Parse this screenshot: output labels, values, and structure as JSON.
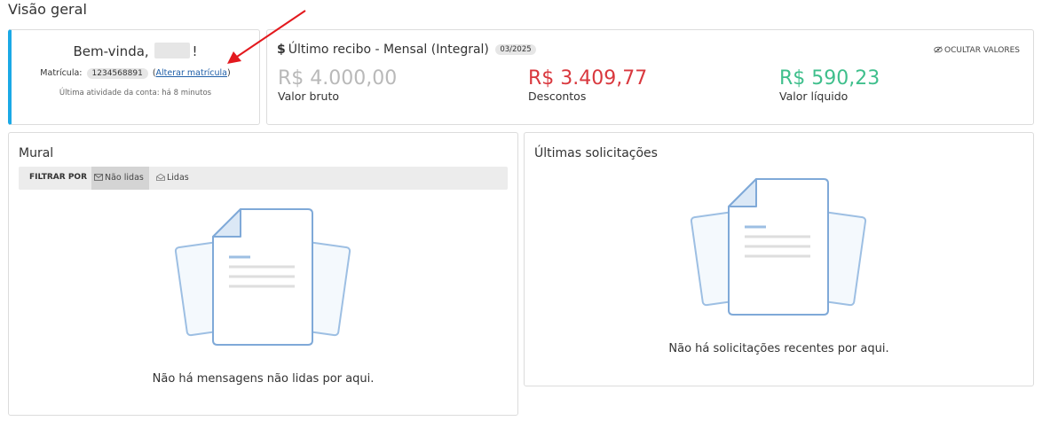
{
  "page": {
    "title": "Visão geral"
  },
  "welcome": {
    "greeting": "Bem-vinda,",
    "exclamation": "!",
    "matricula_label": "Matrícula:",
    "matricula_value": "1234568891",
    "change_link": "Alterar matrícula",
    "paren_open": "(",
    "paren_close": ")",
    "last_activity": "Última atividade da conta: há 8 minutos",
    "accent_color": "#1ba9e6"
  },
  "receipt": {
    "icon": "$",
    "title": "Último recibo - Mensal (Integral)",
    "period": "03/2025",
    "hide_values": "OCULTAR VALORES",
    "gross": {
      "value": "R$ 4.000,00",
      "label": "Valor bruto",
      "color": "#b9b9b9"
    },
    "discounts": {
      "value": "R$ 3.409,77",
      "label": "Descontos",
      "color": "#d9383e"
    },
    "net": {
      "value": "R$ 590,23",
      "label": "Valor líquido",
      "color": "#3fbf8c"
    }
  },
  "mural": {
    "title": "Mural",
    "filter_label": "FILTRAR POR",
    "tabs": [
      {
        "label": "Não lidas",
        "icon": "envelope-closed-icon",
        "active": true
      },
      {
        "label": "Lidas",
        "icon": "envelope-open-icon",
        "active": false
      }
    ],
    "empty_message": "Não há mensagens não lidas por aqui."
  },
  "requests": {
    "title": "Últimas solicitações",
    "empty_message": "Não há solicitações recentes por aqui."
  }
}
